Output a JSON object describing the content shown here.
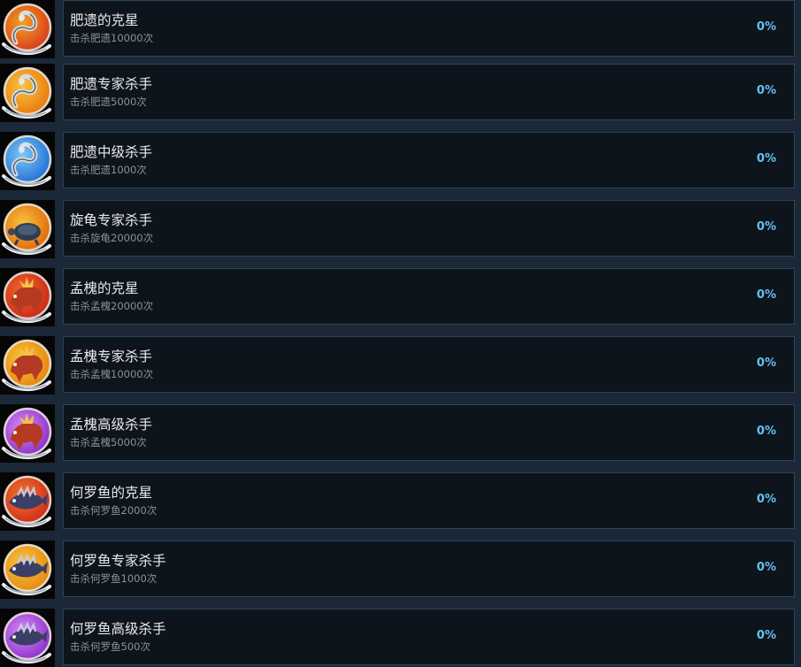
{
  "achievements": [
    {
      "title": "肥遗的克星",
      "desc": "击杀肥遗10000次",
      "percent": "0%",
      "icon": "feiyi-red-icon",
      "color": "#d63a1e",
      "color2": "#f5a21c",
      "creature": "serpent"
    },
    {
      "title": "肥遗专家杀手",
      "desc": "击杀肥遗5000次",
      "percent": "0%",
      "icon": "feiyi-gold-icon",
      "color": "#e8790f",
      "color2": "#f8c33a",
      "creature": "serpent"
    },
    {
      "title": "肥遗中级杀手",
      "desc": "击杀肥遗1000次",
      "percent": "0%",
      "icon": "feiyi-blue-icon",
      "color": "#1f6fd6",
      "color2": "#7dc8f5",
      "creature": "serpent"
    },
    {
      "title": "旋龟专家杀手",
      "desc": "击杀旋龟20000次",
      "percent": "0%",
      "icon": "xuangui-gold-icon",
      "color": "#e0670d",
      "color2": "#f7c23a",
      "creature": "turtle"
    },
    {
      "title": "孟槐的克星",
      "desc": "击杀孟槐20000次",
      "percent": "0%",
      "icon": "menghuai-red-icon",
      "color": "#c9261a",
      "color2": "#f06a2a",
      "creature": "beast"
    },
    {
      "title": "孟槐专家杀手",
      "desc": "击杀孟槐10000次",
      "percent": "0%",
      "icon": "menghuai-gold-icon",
      "color": "#e4840f",
      "color2": "#f8c73e",
      "creature": "beast"
    },
    {
      "title": "孟槐高级杀手",
      "desc": "击杀孟槐5000次",
      "percent": "0%",
      "icon": "menghuai-purple-icon",
      "color": "#8a2fc9",
      "color2": "#d98af5",
      "creature": "beast"
    },
    {
      "title": "何罗鱼的克星",
      "desc": "击杀何罗鱼2000次",
      "percent": "0%",
      "icon": "heluoyu-red-icon",
      "color": "#cf2a1c",
      "color2": "#f07a2c",
      "creature": "fish"
    },
    {
      "title": "何罗鱼专家杀手",
      "desc": "击杀何罗鱼1000次",
      "percent": "0%",
      "icon": "heluoyu-gold-icon",
      "color": "#e5880f",
      "color2": "#f8c63c",
      "creature": "fish"
    },
    {
      "title": "何罗鱼高级杀手",
      "desc": "击杀何罗鱼500次",
      "percent": "0%",
      "icon": "heluoyu-purple-icon",
      "color": "#8b2fcb",
      "color2": "#d68cf4",
      "creature": "fish"
    }
  ]
}
